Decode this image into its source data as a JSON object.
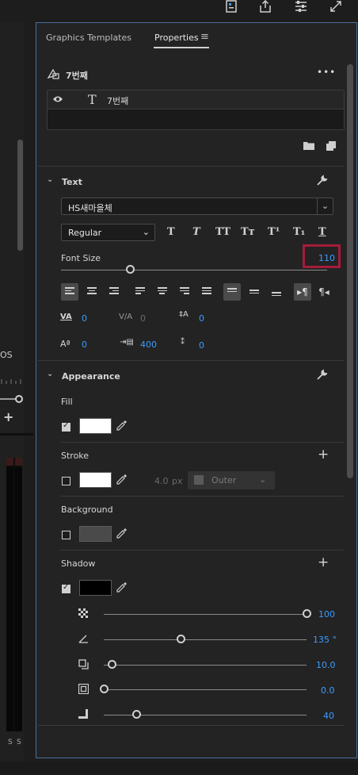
{
  "toolbar": {
    "icons": [
      "panel-icon",
      "share-icon",
      "settings-sliders-icon",
      "expand-icon"
    ]
  },
  "left_strip": {
    "text1": "OS",
    "plus": "+",
    "s_label1": "S",
    "s_label2": "S"
  },
  "tabs": {
    "graphics_templates": "Graphics Templates",
    "properties": "Properties",
    "menu_glyph": "≡"
  },
  "layer": {
    "name": "7번째",
    "item_name": "7번째",
    "more": "•••"
  },
  "text_section": {
    "title": "Text",
    "font_family": "HS새마을체",
    "font_style": "Regular",
    "font_size_label": "Font Size",
    "font_size_value": "110",
    "font_size_fraction": 0.26,
    "tracking_value": "0",
    "kerning_value": "0",
    "leading_value": "0",
    "baseline_value": "0",
    "tab_width_value": "400",
    "tsume_value": "0",
    "format_buttons": [
      "T",
      "T",
      "TT",
      "Tт",
      "T¹",
      "T₁",
      "T"
    ]
  },
  "appearance": {
    "title": "Appearance",
    "fill_label": "Fill",
    "fill_checked": true,
    "fill_color": "#ffffff",
    "stroke_label": "Stroke",
    "stroke_checked": false,
    "stroke_color": "#ffffff",
    "stroke_width": "4.0",
    "stroke_unit": "px",
    "stroke_type": "Outer",
    "background_label": "Background",
    "background_checked": false,
    "background_color": "#4a4a4a",
    "shadow_label": "Shadow",
    "shadow_checked": true,
    "shadow_color": "#000000",
    "plus": "+",
    "shadow_rows": [
      {
        "icon": "opacity-icon",
        "value": "100",
        "fraction": 1.0
      },
      {
        "icon": "angle-icon",
        "value": "135 °",
        "fraction": 0.38
      },
      {
        "icon": "distance-icon",
        "value": "10.0",
        "fraction": 0.04
      },
      {
        "icon": "size-icon",
        "value": "0.0",
        "fraction": 0.0
      },
      {
        "icon": "blur-icon",
        "value": "40",
        "fraction": 0.16
      }
    ]
  },
  "colors": {
    "accent_blue": "#3b9cff",
    "highlight_red": "#a51c3a",
    "panel_border": "#4a6f9c"
  }
}
